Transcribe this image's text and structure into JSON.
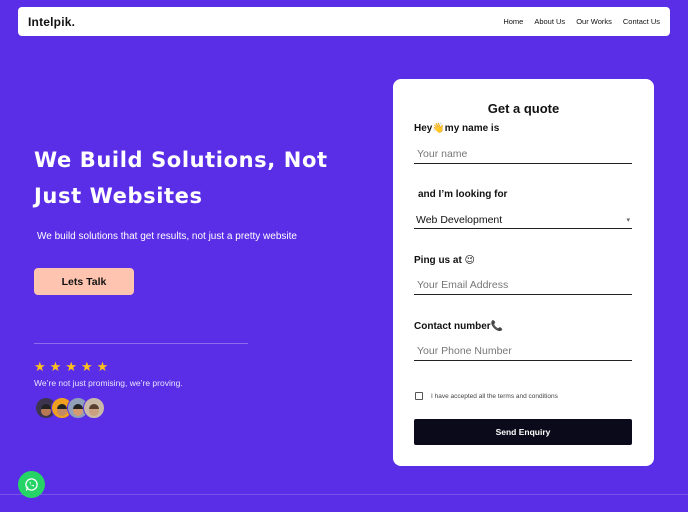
{
  "brand": "Intelpik.",
  "nav": {
    "items": [
      "Home",
      "About Us",
      "Our Works",
      "Contact Us"
    ]
  },
  "hero": {
    "title_line1": "We Build Solutions, Not",
    "title_line2": "Just Websites",
    "subtitle": "We build solutions that get results, not just a pretty website",
    "cta_label": "Lets Talk",
    "rating_stars": 5,
    "proof_text": "We’re not just promising, we’re proving."
  },
  "form": {
    "title": "Get a quote",
    "name_label": "Hey👋my name is",
    "name_placeholder": "Your name",
    "looking_label": "and I’m looking for",
    "service_value": "Web Development",
    "email_label": "Ping us at 😉",
    "email_placeholder": "Your Email Address",
    "phone_label": "Contact number📞",
    "phone_placeholder": "Your Phone Number",
    "terms_label": "I have accepted all the terms and conditions",
    "submit_label": "Send Enquiry"
  },
  "colors": {
    "background": "#5a2ee6",
    "cta": "#ffc4b0",
    "star": "#ffc21a",
    "submit": "#0b0a1a",
    "whatsapp": "#25d366"
  },
  "icons": {
    "star": "star-icon",
    "chevron": "chevron-down-icon",
    "whatsapp": "whatsapp-icon"
  }
}
